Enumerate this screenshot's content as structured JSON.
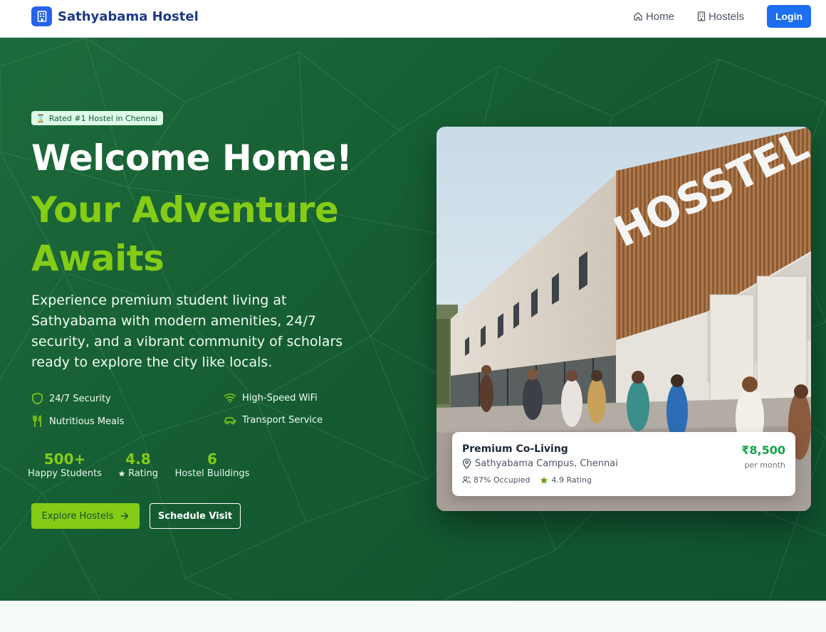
{
  "nav": {
    "brand": "Sathyabama Hostel",
    "links": [
      {
        "label": "Home",
        "icon": "home-icon"
      },
      {
        "label": "Hostels",
        "icon": "building-icon"
      }
    ],
    "login_label": "Login"
  },
  "hero": {
    "badge": "Rated #1 Hostel in Chennai",
    "title_line1": "Welcome Home!",
    "title_line2": "Your Adventure Awaits",
    "description": "Experience premium student living at Sathyabama with modern amenities, 24/7 security, and a vibrant community of scholars ready to explore the city like locals.",
    "features": [
      {
        "label": "24/7 Security",
        "icon": "shield-icon"
      },
      {
        "label": "High-Speed WiFi",
        "icon": "wifi-icon"
      },
      {
        "label": "Nutritious Meals",
        "icon": "utensils-icon"
      },
      {
        "label": "Transport Service",
        "icon": "car-icon"
      }
    ],
    "stats": [
      {
        "value": "500+",
        "label": "Happy Students"
      },
      {
        "value": "4.8",
        "label": "Rating",
        "icon": "star-icon"
      },
      {
        "value": "6",
        "label": "Hostel Buildings"
      }
    ],
    "primary_button": "Explore Hostels",
    "secondary_button": "Schedule Visit"
  },
  "listing": {
    "building_sign": "HOSSTEL",
    "title": "Premium Co-Living",
    "location": "Sathyabama Campus, Chennai",
    "occupancy": "87% Occupied",
    "rating": "4.9 Rating",
    "price": "₹8,500",
    "price_period": "per month"
  },
  "colors": {
    "brand_blue": "#2563eb",
    "hero_green": "#155c32",
    "accent_lime": "#84cc16",
    "price_green": "#16a34a"
  }
}
